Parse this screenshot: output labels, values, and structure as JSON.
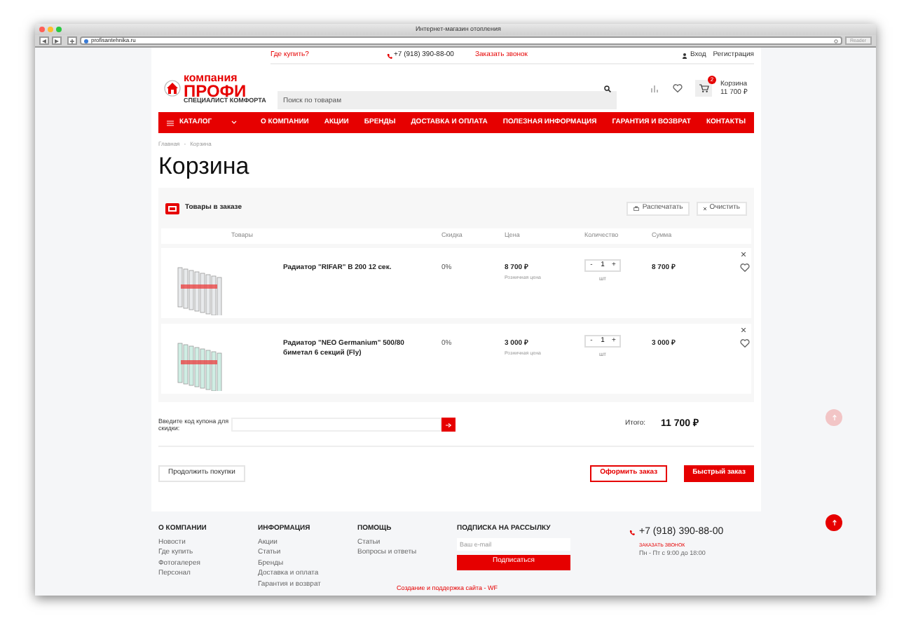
{
  "browser": {
    "title": "Интернет-магазин отопления",
    "url": "profisantehnika.ru",
    "reader": "Reader"
  },
  "topbar": {
    "where_to_buy": "Где купить?",
    "phone": "+7 (918) 390-88-00",
    "callback": "Заказать звонок",
    "login": "Вход",
    "register": "Регистрация"
  },
  "logo": {
    "line1": "компания",
    "line2": "ПРОФИ",
    "tagline": "СПЕЦИАЛИСТ КОМФОРТА"
  },
  "search": {
    "placeholder": "Поиск по товарам"
  },
  "cart_widget": {
    "count": "2",
    "label": "Корзина",
    "total": "11 700 ₽"
  },
  "nav": [
    {
      "kind": "catalog",
      "label": "КАТАЛОГ"
    },
    {
      "kind": "link",
      "label": "О КОМПАНИИ"
    },
    {
      "kind": "link",
      "label": "АКЦИИ"
    },
    {
      "kind": "link",
      "label": "БРЕНДЫ"
    },
    {
      "kind": "link",
      "label": "ДОСТАВКА И ОПЛАТА"
    },
    {
      "kind": "link",
      "label": "ПОЛЕЗНАЯ ИНФОРМАЦИЯ"
    },
    {
      "kind": "link",
      "label": "ГАРАНТИЯ И ВОЗВРАТ"
    },
    {
      "kind": "link",
      "label": "КОНТАКТЫ"
    }
  ],
  "breadcrumb": {
    "items": [
      "Главная",
      "Корзина"
    ],
    "separator": "-"
  },
  "page_title": "Корзина",
  "cart": {
    "title": "Товары в заказе",
    "print_button": "Распечатать",
    "clear_button": "Очистить",
    "columns": [
      "Товары",
      "Скидка",
      "Цена",
      "Количество",
      "Сумма"
    ],
    "rows": [
      {
        "name": "Радиатор \"RIFAR\" B 200 12 сек.",
        "discount": "0%",
        "price": "8 700 ₽",
        "price_note": "Розничная цена",
        "minus": "-",
        "quantity": "1",
        "plus": "+",
        "unit": "шт",
        "sum": "8 700 ₽"
      },
      {
        "name": "Радиатор \"NEO Germanium\" 500/80 биметал 6 секций (Fly)",
        "discount": "0%",
        "price": "3 000 ₽",
        "price_note": "Розничная цена",
        "minus": "-",
        "quantity": "1",
        "plus": "+",
        "unit": "шт",
        "sum": "3 000 ₽"
      }
    ]
  },
  "coupon": {
    "label": "Введите код купона для скидки:"
  },
  "total": {
    "label": "Итого:",
    "value": "11 700 ₽"
  },
  "actions": {
    "continue": "Продолжить покупки",
    "checkout": "Оформить заказ",
    "quick_order": "Быстрый заказ"
  },
  "footer": {
    "columns": [
      {
        "heading": "О КОМПАНИИ",
        "links": [
          "Новости",
          "Где купить",
          "Фотогалерея",
          "Персонал"
        ]
      },
      {
        "heading": "ИНФОРМАЦИЯ",
        "links": [
          "Акции",
          "Статьи",
          "Бренды",
          "Доставка и оплата",
          "Гарантия и возврат"
        ]
      },
      {
        "heading": "ПОМОЩЬ",
        "links": [
          "Статьи",
          "Вопросы и ответы"
        ]
      }
    ],
    "subscribe": {
      "heading": "ПОДПИСКА НА РАССЫЛКУ",
      "placeholder": "Ваш e-mail",
      "button": "Подписаться"
    },
    "contact": {
      "phone": "+7 (918) 390-88-00",
      "callback": "ЗАКАЗАТЬ ЗВОНОК",
      "hours": "Пн - Пт с 9:00 до 18:00"
    },
    "credit": "Создание и поддержка сайта - WF"
  }
}
